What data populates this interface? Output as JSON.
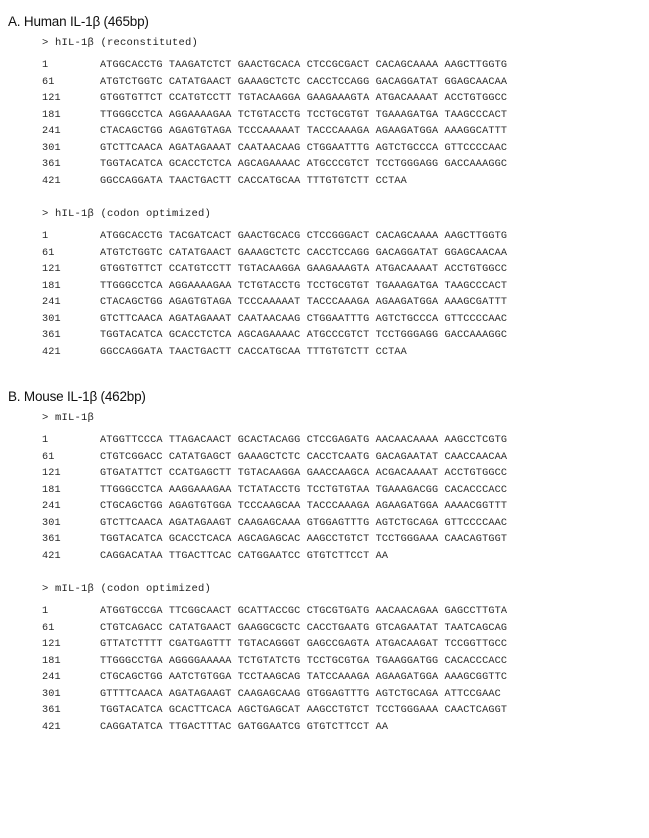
{
  "document": {
    "sections": [
      {
        "id": "human",
        "title": "A. Human IL-1β (465bp)",
        "blocks": [
          {
            "id": "hil1b-reconstituted",
            "header": "> hIL-1β (reconstituted)",
            "rows": [
              {
                "index": "1",
                "bases": "ATGGCACCTG TAAGATCTCT GAACTGCACA CTCCGCGACT CACAGCAAAA AAGCTTGGTG"
              },
              {
                "index": "61",
                "bases": "ATGTCTGGTC CATATGAACT GAAAGCTCTC CACCTCCAGG GACAGGATAT GGAGCAACAA"
              },
              {
                "index": "121",
                "bases": "GTGGTGTTCT CCATGTCCTT TGTACAAGGA GAAGAAAGTA ATGACAAAAT ACCTGTGGCC"
              },
              {
                "index": "181",
                "bases": "TTGGGCCTCA AGGAAAAGAA TCTGTACCTG TCCTGCGTGT TGAAAGATGA TAAGCCCACT"
              },
              {
                "index": "241",
                "bases": "CTACAGCTGG AGAGTGTAGA TCCCAAAAAT TACCCAAAGA AGAAGATGGA AAAGGCATTT"
              },
              {
                "index": "301",
                "bases": "GTCTTCAACA AGATAGAAAT CAATAACAAG CTGGAATTTG AGTCTGCCCA GTTCCCCAAC"
              },
              {
                "index": "361",
                "bases": "TGGTACATCA GCACCTCTCA AGCAGAAAAC ATGCCCGTCT TCCTGGGAGG GACCAAAGGC"
              },
              {
                "index": "421",
                "bases": "GGCCAGGATA TAACTGACTT CACCATGCAA TTTGTGTCTT CCTAA"
              }
            ]
          },
          {
            "id": "hil1b-codon-optimized",
            "header": "> hIL-1β (codon optimized)",
            "rows": [
              {
                "index": "1",
                "bases": "ATGGCACCTG TACGATCACT GAACTGCACG CTCCGGGACT CACAGCAAAA AAGCTTGGTG"
              },
              {
                "index": "61",
                "bases": "ATGTCTGGTC CATATGAACT GAAAGCTCTC CACCTCCAGG GACAGGATAT GGAGCAACAA"
              },
              {
                "index": "121",
                "bases": "GTGGTGTTCT CCATGTCCTT TGTACAAGGA GAAGAAAGTA ATGACAAAAT ACCTGTGGCC"
              },
              {
                "index": "181",
                "bases": "TTGGGCCTCA AGGAAAAGAA TCTGTACCTG TCCTGCGTGT TGAAAGATGA TAAGCCCACT"
              },
              {
                "index": "241",
                "bases": "CTACAGCTGG AGAGTGTAGA TCCCAAAAAT TACCCAAAGA AGAAGATGGA AAAGCGATTT"
              },
              {
                "index": "301",
                "bases": "GTCTTCAACA AGATAGAAAT CAATAACAAG CTGGAATTTG AGTCTGCCCA GTTCCCCAAC"
              },
              {
                "index": "361",
                "bases": "TGGTACATCA GCACCTCTCA AGCAGAAAAC ATGCCCGTCT TCCTGGGAGG GACCAAAGGC"
              },
              {
                "index": "421",
                "bases": "GGCCAGGATA TAACTGACTT CACCATGCAA TTTGTGTCTT CCTAA"
              }
            ]
          }
        ]
      },
      {
        "id": "mouse",
        "title": "B. Mouse IL-1β (462bp)",
        "blocks": [
          {
            "id": "mil1b",
            "header": "> mIL-1β",
            "rows": [
              {
                "index": "1",
                "bases": "ATGGTTCCCA TTAGACAACT GCACTACAGG CTCCGAGATG AACAACAAAA AAGCCTCGTG"
              },
              {
                "index": "61",
                "bases": "CTGTCGGACC CATATGAGCT GAAAGCTCTC CACCTCAATG GACAGAATAT CAACCAACAA"
              },
              {
                "index": "121",
                "bases": "GTGATATTCT CCATGAGCTT TGTACAAGGA GAACCAAGCA ACGACAAAAT ACCTGTGGCC"
              },
              {
                "index": "181",
                "bases": "TTGGGCCTCA AAGGAAAGAA TCTATACCTG TCCTGTGTAA TGAAAGACGG CACACCCACC"
              },
              {
                "index": "241",
                "bases": "CTGCAGCTGG AGAGTGTGGA TCCCAAGCAA TACCCAAAGA AGAAGATGGA AAAACGGTTT"
              },
              {
                "index": "301",
                "bases": "GTCTTCAACA AGATAGAAGT CAAGAGCAAA GTGGAGTTTG AGTCTGCAGA GTTCCCCAAC"
              },
              {
                "index": "361",
                "bases": "TGGTACATCA GCACCTCACA AGCAGAGCAC AAGCCTGTCT TCCTGGGAAA CAACAGTGGT"
              },
              {
                "index": "421",
                "bases": "CAGGACATAA TTGACTTCAC CATGGAATCC GTGTCTTCCT AA"
              }
            ]
          },
          {
            "id": "mil1b-codon-optimized",
            "header": "> mIL-1β (codon optimized)",
            "rows": [
              {
                "index": "1",
                "bases": "ATGGTGCCGA TTCGGCAACT GCATTACCGC CTGCGTGATG AACAACAGAA GAGCCTTGTA"
              },
              {
                "index": "61",
                "bases": "CTGTCAGACC CATATGAACT GAAGGCGCTC CACCTGAATG GTCAGAATAT TAATCAGCAG"
              },
              {
                "index": "121",
                "bases": "GTTATCTTTT CGATGAGTTT TGTACAGGGT GAGCCGAGTA ATGACAAGAT TCCGGTTGCC"
              },
              {
                "index": "181",
                "bases": "TTGGGCCTGA AGGGGAAAAA TCTGTATCTG TCCTGCGTGA TGAAGGATGG CACACCCACC"
              },
              {
                "index": "241",
                "bases": "CTGCAGCTGG AATCTGTGGA TCCTAAGCAG TATCCAAAGA AGAAGATGGA AAAGCGGTTC"
              },
              {
                "index": "301",
                "bases": "GTTTTCAACA AGATAGAAGT CAAGAGCAAG GTGGAGTTTG AGTCTGCAGA ATTCCGAAC"
              },
              {
                "index": "361",
                "bases": "TGGTACATCA GCACTTCACA AGCTGAGCAT AAGCCTGTCT TCCTGGGAAA CAACTCAGGT"
              },
              {
                "index": "421",
                "bases": "CAGGATATCA TTGACTTTAC GATGGAATCG GTGTCTTCCT AA"
              }
            ]
          }
        ]
      }
    ]
  }
}
